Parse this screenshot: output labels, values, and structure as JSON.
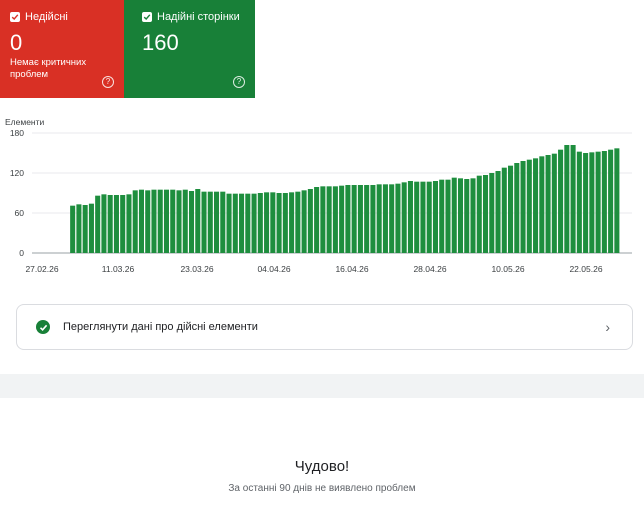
{
  "tiles": {
    "invalid": {
      "label": "Недійсні",
      "count": "0",
      "subtext": "Немає критичних проблем",
      "color": "#d93025",
      "help_icon": "help-circle-icon"
    },
    "valid": {
      "label": "Надійні сторінки",
      "count": "160",
      "color": "#188038",
      "help_icon": "help-circle-icon"
    }
  },
  "chart_data": {
    "type": "bar",
    "title": "",
    "ylabel": "Елементи",
    "xlabel": "",
    "ylim": [
      0,
      180
    ],
    "yticks": [
      0,
      60,
      120,
      180
    ],
    "xtick_labels": [
      "27.02.26",
      "11.03.26",
      "23.03.26",
      "04.04.26",
      "16.04.26",
      "28.04.26",
      "10.05.26",
      "22.05.26"
    ],
    "color": "#1e8e3e",
    "values": [
      0,
      0,
      0,
      0,
      0,
      0,
      71,
      73,
      72,
      74,
      86,
      88,
      87,
      87,
      87,
      88,
      94,
      95,
      94,
      95,
      95,
      95,
      95,
      94,
      95,
      93,
      96,
      92,
      92,
      92,
      92,
      89,
      89,
      89,
      89,
      89,
      90,
      91,
      91,
      90,
      90,
      91,
      92,
      94,
      96,
      99,
      100,
      100,
      100,
      101,
      102,
      102,
      102,
      102,
      102,
      103,
      103,
      103,
      104,
      106,
      108,
      107,
      107,
      107,
      108,
      110,
      110,
      113,
      112,
      111,
      112,
      116,
      117,
      120,
      123,
      128,
      131,
      135,
      138,
      140,
      142,
      145,
      147,
      149,
      155,
      162,
      162,
      152,
      150,
      151,
      152,
      153,
      155,
      157
    ]
  },
  "action": {
    "label": "Переглянути дані про дійсні елементи",
    "icon": "check-circle-icon",
    "chevron": "›"
  },
  "status": {
    "title": "Чудово!",
    "subtitle": "За останні 90 днів не виявлено проблем"
  }
}
